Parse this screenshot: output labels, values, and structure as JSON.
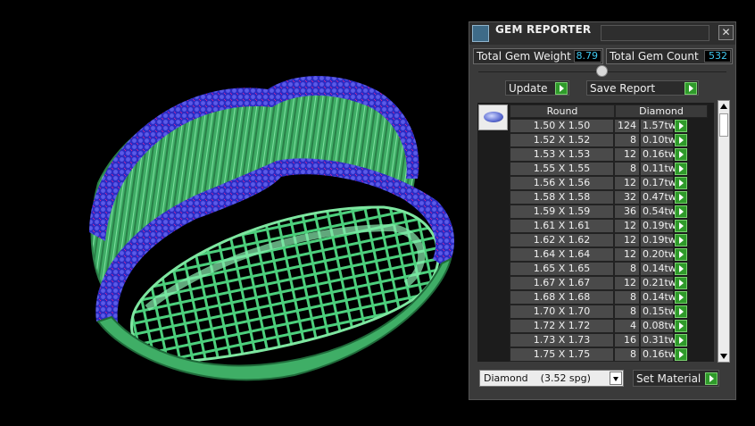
{
  "panel": {
    "title": "GEM REPORTER",
    "close_glyph": "✕",
    "stats": {
      "total_weight_label": "Total Gem Weight",
      "total_weight_value": "8.79",
      "total_count_label": "Total Gem Count",
      "total_count_value": "532"
    },
    "buttons": {
      "update": "Update",
      "save_report": "Save Report",
      "set_material": "Set Material"
    },
    "table": {
      "headers": {
        "shape": "Round",
        "material": "Diamond"
      },
      "rows": [
        {
          "size": "1.50 X 1.50",
          "count": "124",
          "weight": "1.57tw"
        },
        {
          "size": "1.52 X 1.52",
          "count": "8",
          "weight": "0.10tw"
        },
        {
          "size": "1.53 X 1.53",
          "count": "12",
          "weight": "0.16tw"
        },
        {
          "size": "1.55 X 1.55",
          "count": "8",
          "weight": "0.11tw"
        },
        {
          "size": "1.56 X 1.56",
          "count": "12",
          "weight": "0.17tw"
        },
        {
          "size": "1.58 X 1.58",
          "count": "32",
          "weight": "0.47tw"
        },
        {
          "size": "1.59 X 1.59",
          "count": "36",
          "weight": "0.54tw"
        },
        {
          "size": "1.61 X 1.61",
          "count": "12",
          "weight": "0.19tw"
        },
        {
          "size": "1.62 X 1.62",
          "count": "12",
          "weight": "0.19tw"
        },
        {
          "size": "1.64 X 1.64",
          "count": "12",
          "weight": "0.20tw"
        },
        {
          "size": "1.65 X 1.65",
          "count": "8",
          "weight": "0.14tw"
        },
        {
          "size": "1.67 X 1.67",
          "count": "12",
          "weight": "0.21tw"
        },
        {
          "size": "1.68 X 1.68",
          "count": "8",
          "weight": "0.14tw"
        },
        {
          "size": "1.70 X 1.70",
          "count": "8",
          "weight": "0.15tw"
        },
        {
          "size": "1.72 X 1.72",
          "count": "4",
          "weight": "0.08tw"
        },
        {
          "size": "1.73 X 1.73",
          "count": "16",
          "weight": "0.31tw"
        },
        {
          "size": "1.75 X 1.75",
          "count": "8",
          "weight": "0.16tw"
        }
      ]
    },
    "material_select": {
      "value": "Diamond    (3.52 spg)"
    }
  },
  "icons": {
    "panel": "gem-reporter-icon",
    "gem": "round-gem-icon",
    "go": "green-play-arrow-icon"
  },
  "colors": {
    "ring_metal": "#4fc47a",
    "gems": "#3a3ad0",
    "prongs": "#d21a8a",
    "value_text": "#3fc7ef",
    "go_button": "#2f9a2a"
  }
}
